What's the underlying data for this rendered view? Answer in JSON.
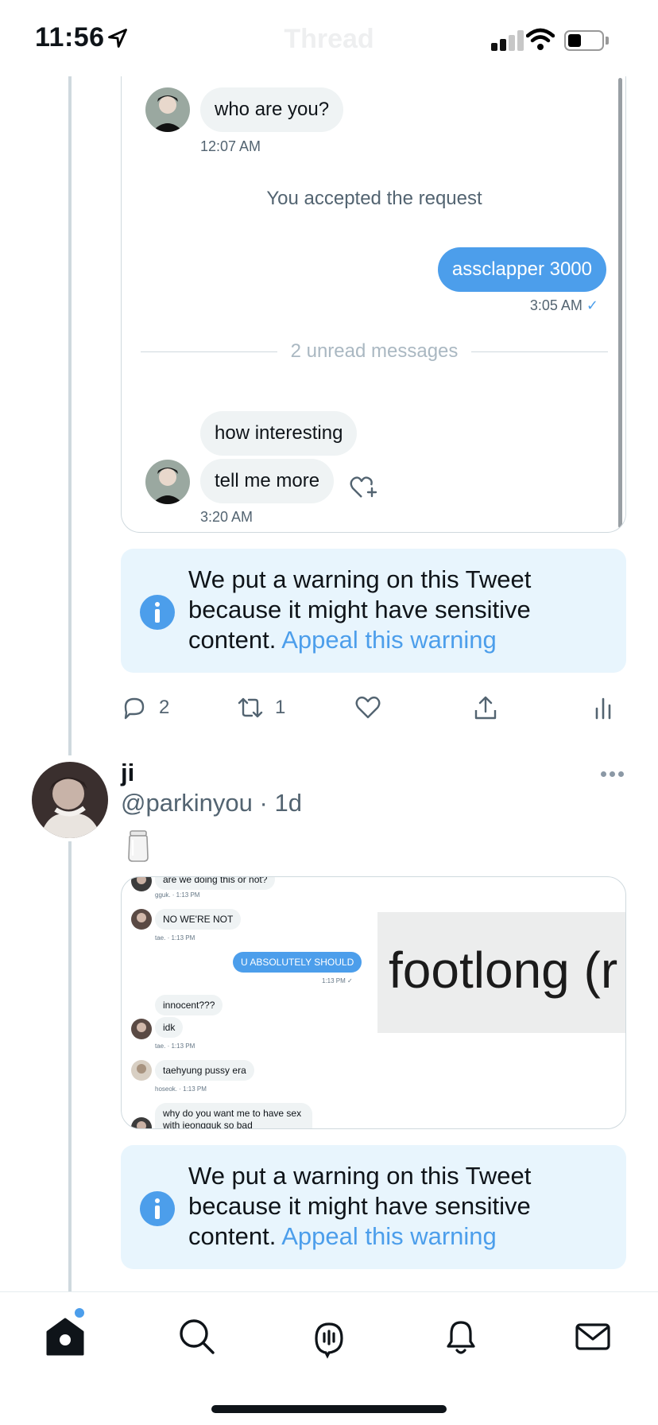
{
  "status_bar": {
    "time": "11:56",
    "nav_title": "Thread"
  },
  "dm": {
    "messages": [
      {
        "text": "who are you?",
        "time": "12:07 AM"
      },
      {
        "system": "You accepted the request"
      },
      {
        "text": "assclapper 3000",
        "time": "3:05 AM",
        "check": "✓"
      },
      {
        "divider": "2 unread messages"
      },
      {
        "text": "how interesting"
      },
      {
        "text": "tell me more",
        "time": "3:20 AM"
      }
    ]
  },
  "warning": {
    "text": "We put a warning on this Tweet because it might have sensitive content.",
    "link": "Appeal this warning"
  },
  "actions": {
    "replies": "2",
    "retweets": "1"
  },
  "tweet": {
    "name": "ji",
    "handle": "@parkinyou",
    "separator": " · ",
    "time": "1d",
    "emoji": "jar-emoji"
  },
  "media": {
    "lines": [
      {
        "text": "are we doing this or not?",
        "meta": "gguk. · 1:13 PM"
      },
      {
        "text": "NO WE'RE NOT",
        "meta": "tae. · 1:13 PM"
      },
      {
        "text": "U ABSOLUTELY SHOULD",
        "meta": "1:13 PM ✓"
      },
      {
        "text": "innocent???"
      },
      {
        "text": "idk",
        "meta": "tae. · 1:13 PM"
      },
      {
        "text": "taehyung pussy era",
        "meta": "hoseok. · 1:13 PM"
      },
      {
        "text": "why do you want me to have sex with jeongguk so bad"
      }
    ],
    "overlay_text": "footlong (r"
  },
  "tabs": [
    "home-icon",
    "search-icon",
    "spaces-icon",
    "notifications-icon",
    "messages-icon"
  ],
  "colors": {
    "accent": "#4c9eeb",
    "warning_bg": "#e8f5fd",
    "text": "#0f1419",
    "muted": "#536471"
  }
}
